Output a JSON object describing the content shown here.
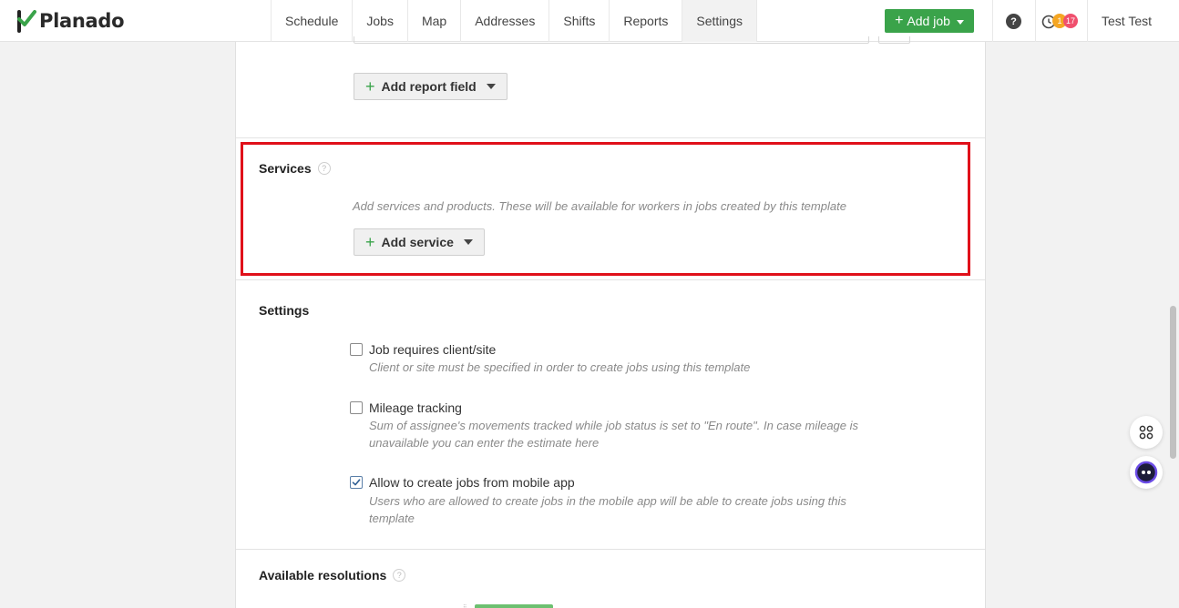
{
  "brand": {
    "name": "Planado",
    "accent": "#3aa34a"
  },
  "nav": [
    {
      "label": "Schedule",
      "active": false
    },
    {
      "label": "Jobs",
      "active": false
    },
    {
      "label": "Map",
      "active": false
    },
    {
      "label": "Addresses",
      "active": false
    },
    {
      "label": "Shifts",
      "active": false
    },
    {
      "label": "Reports",
      "active": false
    },
    {
      "label": "Settings",
      "active": true
    }
  ],
  "header": {
    "add_job_label": "Add job",
    "help_label": "?",
    "notifications": {
      "orange": "1",
      "red": "17"
    },
    "user_name": "Test Test"
  },
  "report_fields": {
    "add_label": "Add report field"
  },
  "services": {
    "title": "Services",
    "hint": "Add services and products. These will be available for workers in jobs created by this template",
    "add_label": "Add service"
  },
  "settings": {
    "title": "Settings",
    "options": [
      {
        "label": "Job requires client/site",
        "hint": "Client or site must be specified in order to create jobs using this template",
        "checked": false
      },
      {
        "label": "Mileage tracking",
        "hint": "Sum of assignee's movements tracked while job status is set to \"En route\". In case mileage is unavailable you can enter the estimate here",
        "checked": false
      },
      {
        "label": "Allow to create jobs from mobile app",
        "hint": "Users who are allowed to create jobs in the mobile app will be able to create jobs using this template",
        "checked": true
      }
    ]
  },
  "resolutions": {
    "title": "Available resolutions"
  },
  "colors": {
    "highlight": "#e0101a",
    "badge_orange": "#f5a623",
    "badge_red": "#f0506e",
    "assistant": "#6b4ce6"
  },
  "icons": {
    "apps": "apps-grid-icon",
    "assistant": "assistant-face-icon",
    "clock": "clock-icon"
  }
}
